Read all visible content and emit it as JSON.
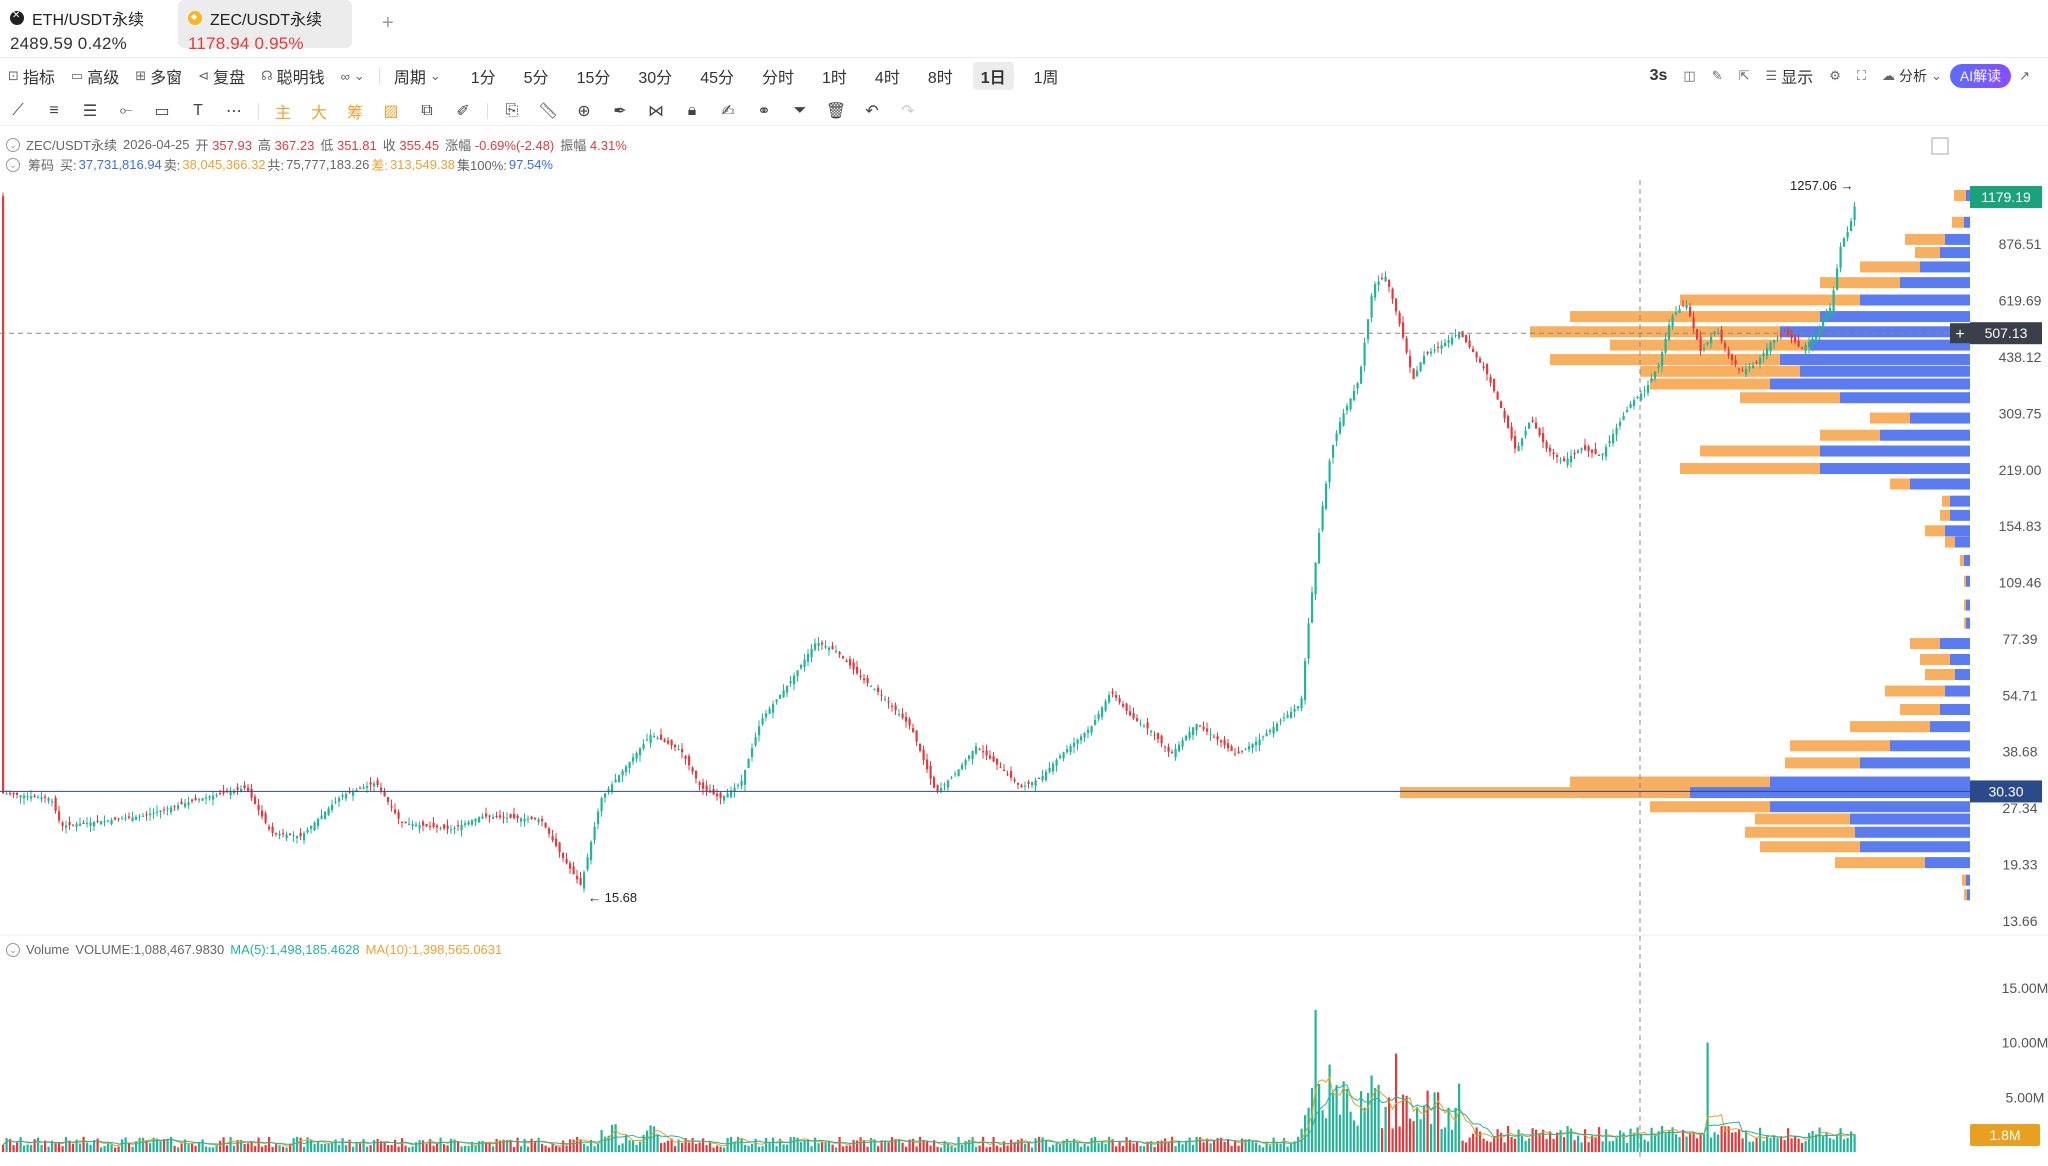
{
  "tabs": [
    {
      "icon": "eth-icon",
      "name": "ETH/USDT永续",
      "price": "2489.59",
      "change": "0.42%",
      "color": "#222222"
    },
    {
      "icon": "zec-icon",
      "name": "ZEC/USDT永续",
      "price": "1178.94",
      "change": "0.95%",
      "color": "#e5393b"
    }
  ],
  "add_tab": "+",
  "toolbar": {
    "left": [
      {
        "icon": "indicator-icon",
        "label": "指标"
      },
      {
        "icon": "advanced-icon",
        "label": "高级"
      },
      {
        "icon": "multiwindow-icon",
        "label": "多窗"
      },
      {
        "icon": "replay-icon",
        "label": "复盘"
      },
      {
        "icon": "smartmoney-icon",
        "label": "聪明钱"
      },
      {
        "icon": "pattern-icon",
        "label": "∞"
      }
    ],
    "period_label": "周期",
    "intervals": [
      "1分",
      "5分",
      "15分",
      "30分",
      "45分",
      "分时",
      "1时",
      "4时",
      "8时",
      "1日",
      "1周"
    ],
    "active_interval": "1日",
    "right": {
      "refresh": "3s",
      "display": "显示",
      "analysis": "分析",
      "ai": "AI解读"
    }
  },
  "drawtools": {
    "main": "主",
    "big": "大",
    "chip": "筹"
  },
  "info_line1": {
    "symbol": "ZEC/USDT永续",
    "date": "2026-04-25",
    "open_label": "开",
    "open": "357.93",
    "high_label": "高",
    "high": "367.23",
    "low_label": "低",
    "low": "351.81",
    "close_label": "收",
    "close": "355.45",
    "chg_label": "涨幅",
    "chg": "-0.69%(-2.48)",
    "amp_label": "振幅",
    "amp": "4.31%"
  },
  "info_line2": {
    "label": "筹码",
    "buy_label": "买:",
    "buy": "37,731,816.94",
    "sell_label": "卖:",
    "sell": "38,045,366.32",
    "total_label": "共:",
    "total": "75,777,183.26",
    "diff_label": "差:",
    "diff": "313,549.38",
    "conc_label": "集100%:",
    "conc": "97.54%"
  },
  "volume_info": {
    "label": "Volume",
    "vol": "VOLUME:1,088,467.9830",
    "ma5": "MA(5):1,498,185.4628",
    "ma10": "MA(10):1,398,565.0631"
  },
  "price_axis": [
    "876.51",
    "619.69",
    "438.12",
    "309.75",
    "219.00",
    "154.83",
    "109.46",
    "77.39",
    "54.71",
    "38.68",
    "27.34",
    "19.33",
    "13.66"
  ],
  "price_tags": {
    "last": "1179.19",
    "cursor": "507.13",
    "poc": "30.30"
  },
  "annotations": {
    "high": "1257.06",
    "low": "15.68"
  },
  "volume_axis": [
    "15.00M",
    "10.00M",
    "5.00M"
  ],
  "volume_tag": "1.8M",
  "colors": {
    "up": "#22b59a",
    "down": "#e5393b",
    "buy": "#5b7bf0",
    "sell": "#f8b060",
    "ma5": "#e8a020",
    "ma10": "#22b59a"
  },
  "chart_data": {
    "type": "candlestick",
    "scale": "log",
    "ylim": [
      13.66,
      1257.06
    ],
    "path": [
      [
        0,
        30
      ],
      [
        50,
        29
      ],
      [
        60,
        24.5
      ],
      [
        140,
        26
      ],
      [
        200,
        29
      ],
      [
        245,
        31
      ],
      [
        270,
        23.5
      ],
      [
        300,
        23
      ],
      [
        340,
        29.5
      ],
      [
        375,
        32
      ],
      [
        400,
        25
      ],
      [
        450,
        24
      ],
      [
        480,
        26
      ],
      [
        540,
        25.5
      ],
      [
        560,
        20.5
      ],
      [
        580,
        17
      ],
      [
        600,
        29
      ],
      [
        620,
        34
      ],
      [
        650,
        43
      ],
      [
        680,
        39
      ],
      [
        700,
        31
      ],
      [
        720,
        29
      ],
      [
        740,
        32
      ],
      [
        760,
        47
      ],
      [
        790,
        60
      ],
      [
        815,
        76
      ],
      [
        835,
        72
      ],
      [
        860,
        61
      ],
      [
        880,
        55
      ],
      [
        910,
        45
      ],
      [
        935,
        30
      ],
      [
        955,
        34
      ],
      [
        975,
        40
      ],
      [
        1000,
        35
      ],
      [
        1020,
        31
      ],
      [
        1040,
        33
      ],
      [
        1060,
        38
      ],
      [
        1090,
        45
      ],
      [
        1110,
        56
      ],
      [
        1130,
        48
      ],
      [
        1150,
        44
      ],
      [
        1170,
        38
      ],
      [
        1195,
        46
      ],
      [
        1215,
        42
      ],
      [
        1235,
        38
      ],
      [
        1260,
        42
      ],
      [
        1280,
        47
      ],
      [
        1300,
        52
      ],
      [
        1308,
        88
      ],
      [
        1320,
        165
      ],
      [
        1330,
        245
      ],
      [
        1340,
        300
      ],
      [
        1358,
        380
      ],
      [
        1372,
        680
      ],
      [
        1385,
        720
      ],
      [
        1400,
        520
      ],
      [
        1412,
        380
      ],
      [
        1422,
        440
      ],
      [
        1440,
        470
      ],
      [
        1458,
        510
      ],
      [
        1470,
        460
      ],
      [
        1485,
        400
      ],
      [
        1500,
        320
      ],
      [
        1515,
        245
      ],
      [
        1530,
        300
      ],
      [
        1545,
        250
      ],
      [
        1562,
        230
      ],
      [
        1580,
        250
      ],
      [
        1600,
        238
      ],
      [
        1616,
        285
      ],
      [
        1630,
        330
      ],
      [
        1645,
        360
      ],
      [
        1658,
        420
      ],
      [
        1670,
        560
      ],
      [
        1685,
        610
      ],
      [
        1700,
        450
      ],
      [
        1715,
        520
      ],
      [
        1728,
        440
      ],
      [
        1740,
        400
      ],
      [
        1755,
        420
      ],
      [
        1770,
        480
      ],
      [
        1785,
        510
      ],
      [
        1800,
        460
      ],
      [
        1815,
        500
      ],
      [
        1830,
        600
      ],
      [
        1840,
        880
      ],
      [
        1848,
        960
      ],
      [
        1856,
        1179
      ]
    ],
    "chip_profile": [
      [
        1179,
        4,
        12
      ],
      [
        1000,
        6,
        12
      ],
      [
        900,
        25,
        40
      ],
      [
        830,
        30,
        25
      ],
      [
        760,
        50,
        60
      ],
      [
        690,
        70,
        80
      ],
      [
        620,
        110,
        180
      ],
      [
        560,
        150,
        250
      ],
      [
        510,
        190,
        250
      ],
      [
        470,
        160,
        200
      ],
      [
        430,
        190,
        230
      ],
      [
        400,
        170,
        160
      ],
      [
        370,
        200,
        120
      ],
      [
        340,
        130,
        100
      ],
      [
        300,
        60,
        40
      ],
      [
        270,
        90,
        60
      ],
      [
        245,
        150,
        120
      ],
      [
        220,
        150,
        140
      ],
      [
        200,
        60,
        20
      ],
      [
        180,
        20,
        8
      ],
      [
        165,
        20,
        10
      ],
      [
        150,
        25,
        20
      ],
      [
        140,
        15,
        10
      ],
      [
        125,
        6,
        4
      ],
      [
        110,
        4,
        2
      ],
      [
        95,
        4,
        2
      ],
      [
        85,
        4,
        2
      ],
      [
        75,
        30,
        30
      ],
      [
        68,
        20,
        30
      ],
      [
        62,
        15,
        30
      ],
      [
        56,
        25,
        60
      ],
      [
        50,
        30,
        40
      ],
      [
        45,
        40,
        80
      ],
      [
        40,
        80,
        100
      ],
      [
        36,
        110,
        75
      ],
      [
        32,
        200,
        200
      ],
      [
        30,
        280,
        290
      ],
      [
        27.5,
        200,
        120
      ],
      [
        25.5,
        120,
        95
      ],
      [
        23.5,
        115,
        110
      ],
      [
        21.5,
        110,
        100
      ],
      [
        19.5,
        45,
        90
      ],
      [
        17.5,
        4,
        4
      ],
      [
        16,
        3,
        3
      ]
    ],
    "volume_spikes": [
      [
        1313,
        13
      ],
      [
        1330,
        8
      ],
      [
        1372,
        7
      ],
      [
        1395,
        9
      ],
      [
        1705,
        17
      ],
      [
        1708,
        10
      ]
    ]
  }
}
